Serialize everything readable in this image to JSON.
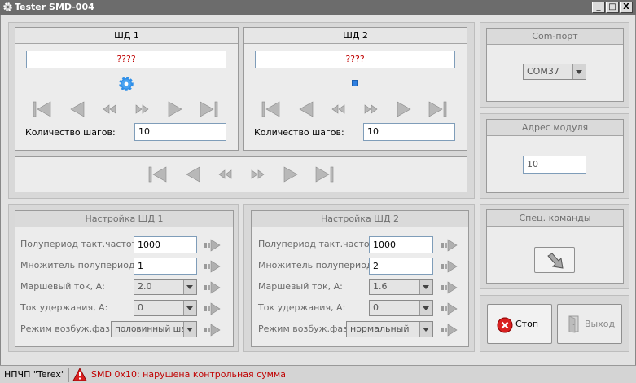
{
  "window": {
    "title": "Tester SMD-004",
    "minimize": "_",
    "maximize": "□",
    "close": "X"
  },
  "sd1": {
    "title": "ШД 1",
    "display": "????",
    "steps_label": "Количество шагов:",
    "steps_value": "10"
  },
  "sd2": {
    "title": "ШД 2",
    "display": "????",
    "steps_label": "Количество шагов:",
    "steps_value": "10"
  },
  "com": {
    "title": "Com-порт",
    "value": "COM37"
  },
  "address": {
    "title": "Адрес модуля",
    "value": "10"
  },
  "special": {
    "title": "Спец. команды"
  },
  "settings1": {
    "title": "Настройка ШД 1",
    "half_period_label": "Полупериод такт.частоты:",
    "half_period_value": "1000",
    "multiplier_label": "Множитель полупериода:",
    "multiplier_value": "1",
    "march_current_label": "Маршевый ток, А:",
    "march_current_value": "2.0",
    "hold_current_label": "Ток удержания, А:",
    "hold_current_value": "0",
    "phase_mode_label": "Режим возбуж.фаз:",
    "phase_mode_value": "половинный шаг"
  },
  "settings2": {
    "title": "Настройка ШД 2",
    "half_period_label": "Полупериод такт.частоты:",
    "half_period_value": "1000",
    "multiplier_label": "Множитель полупериода:",
    "multiplier_value": "2",
    "march_current_label": "Маршевый ток, А:",
    "march_current_value": "1.6",
    "hold_current_label": "Ток удержания, А:",
    "hold_current_value": "0",
    "phase_mode_label": "Режим возбуж.фаз:",
    "phase_mode_value": "нормальный"
  },
  "buttons": {
    "stop": "Стоп",
    "exit": "Выход"
  },
  "status": {
    "company": "НПЧП \"Terex\"",
    "message": "SMD 0x10: нарушена контрольная сумма"
  },
  "icons": {
    "busy": "gear-icon",
    "nav": [
      "first-icon",
      "prev-icon",
      "rewind-icon",
      "fast-forward-icon",
      "next-icon",
      "last-icon"
    ]
  },
  "colors": {
    "error_text": "#c00000",
    "gear": "#2f8fe8",
    "stop": "#d92020"
  }
}
